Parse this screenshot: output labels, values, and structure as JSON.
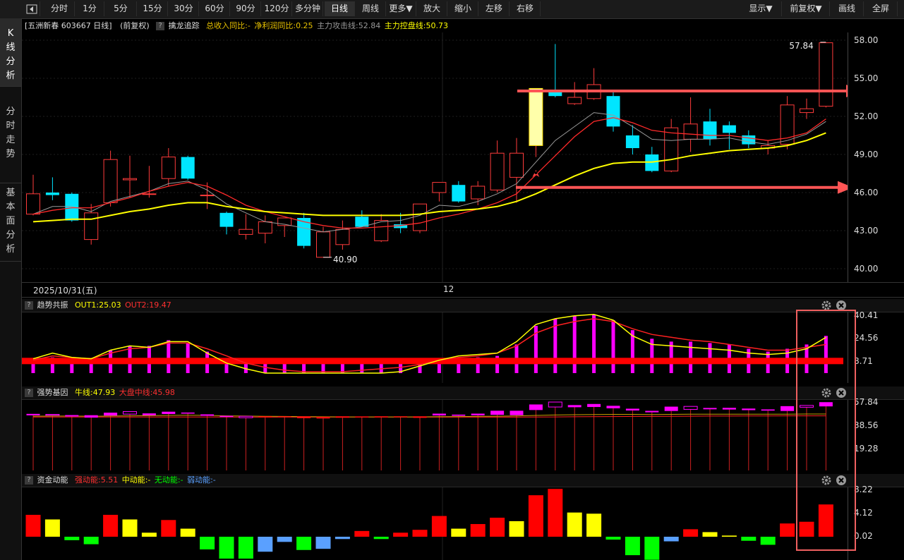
{
  "toolbar": {
    "collapse_icon": "collapse-left-icon",
    "periods": [
      "分时",
      "1分",
      "5分",
      "15分",
      "30分",
      "60分",
      "90分",
      "120分",
      "多分钟",
      "日线",
      "周线",
      "更多▼"
    ],
    "active_period": "日线",
    "actions": [
      "放大",
      "缩小",
      "左移",
      "右移"
    ],
    "right": [
      "显示▼",
      "前复权▼",
      "画线",
      "全屏"
    ]
  },
  "leftnav": [
    {
      "label": "K线分析",
      "active": true
    },
    {
      "label": "分时走势",
      "active": false
    },
    {
      "label": "基本面分析",
      "active": false
    }
  ],
  "main_chart": {
    "header": {
      "stock": "[五洲新春 603667 日线]",
      "adjust": "(前复权)",
      "indicator": "擒龙追踪",
      "items": [
        {
          "text": "总收入同比:-",
          "color": "#e8c200"
        },
        {
          "text": "净利润同比:0.25",
          "color": "#e8c200"
        },
        {
          "text": "主力攻击线:52.84",
          "color": "#999999"
        },
        {
          "text": "主力控盘线:50.73",
          "color": "#ffff00"
        }
      ]
    },
    "y_ticks": [
      "58.00",
      "55.00",
      "52.00",
      "49.00",
      "46.00",
      "43.00",
      "40.00"
    ],
    "high_label": "57.84",
    "low_label": "40.90",
    "date_label": "2025/10/31(五)",
    "month_label": "12",
    "colors": {
      "up": "#ff3b3b",
      "down": "#00e5ff",
      "ma_fast": "#dddddd",
      "ma_red": "#ff2a2a",
      "ma_yellow": "#ffff00",
      "arrow": "#ff5555",
      "highlight": "#ffffaa"
    }
  },
  "candles": [
    {
      "o": 44.3,
      "h": 47.4,
      "l": 44.2,
      "c": 45.9
    },
    {
      "o": 46.0,
      "h": 47.2,
      "l": 45.4,
      "c": 45.8
    },
    {
      "o": 45.9,
      "h": 46.0,
      "l": 43.7,
      "c": 43.8
    },
    {
      "o": 42.3,
      "h": 45.1,
      "l": 41.9,
      "c": 44.4
    },
    {
      "o": 45.2,
      "h": 49.3,
      "l": 44.9,
      "c": 48.6
    },
    {
      "o": 47.0,
      "h": 48.9,
      "l": 45.6,
      "c": 47.1
    },
    {
      "o": 45.9,
      "h": 48.1,
      "l": 45.6,
      "c": 45.9
    },
    {
      "o": 47.1,
      "h": 49.5,
      "l": 46.5,
      "c": 48.8
    },
    {
      "o": 48.8,
      "h": 48.9,
      "l": 47.0,
      "c": 47.1
    },
    {
      "o": 45.8,
      "h": 46.8,
      "l": 44.7,
      "c": 45.8
    },
    {
      "o": 44.4,
      "h": 44.5,
      "l": 42.7,
      "c": 43.3
    },
    {
      "o": 42.7,
      "h": 44.3,
      "l": 42.3,
      "c": 43.1
    },
    {
      "o": 42.8,
      "h": 44.2,
      "l": 42.0,
      "c": 43.7
    },
    {
      "o": 43.4,
      "h": 43.9,
      "l": 42.5,
      "c": 44.0
    },
    {
      "o": 44.0,
      "h": 44.4,
      "l": 41.6,
      "c": 41.8
    },
    {
      "o": 40.9,
      "h": 43.3,
      "l": 40.9,
      "c": 42.9
    },
    {
      "o": 41.9,
      "h": 43.8,
      "l": 41.5,
      "c": 43.1
    },
    {
      "o": 44.1,
      "h": 44.6,
      "l": 43.3,
      "c": 43.3
    },
    {
      "o": 42.2,
      "h": 44.3,
      "l": 42.1,
      "c": 43.8
    },
    {
      "o": 43.5,
      "h": 44.4,
      "l": 42.8,
      "c": 43.2
    },
    {
      "o": 43.0,
      "h": 45.1,
      "l": 42.8,
      "c": 45.1
    },
    {
      "o": 46.0,
      "h": 46.7,
      "l": 45.3,
      "c": 46.8
    },
    {
      "o": 46.6,
      "h": 46.9,
      "l": 45.2,
      "c": 45.3
    },
    {
      "o": 45.5,
      "h": 46.9,
      "l": 45.0,
      "c": 46.5
    },
    {
      "o": 46.2,
      "h": 50.1,
      "l": 46.0,
      "c": 49.1
    },
    {
      "o": 47.2,
      "h": 50.3,
      "l": 45.2,
      "c": 49.1
    },
    {
      "o": 49.7,
      "h": 54.2,
      "l": 48.8,
      "c": 54.2,
      "highlight": true
    },
    {
      "o": 54.0,
      "h": 57.7,
      "l": 53.5,
      "c": 53.6
    },
    {
      "o": 53.0,
      "h": 54.7,
      "l": 52.9,
      "c": 53.5
    },
    {
      "o": 53.4,
      "h": 55.8,
      "l": 53.3,
      "c": 54.5
    },
    {
      "o": 53.6,
      "h": 53.9,
      "l": 50.8,
      "c": 51.2
    },
    {
      "o": 50.5,
      "h": 51.3,
      "l": 49.0,
      "c": 49.5
    },
    {
      "o": 49.0,
      "h": 49.6,
      "l": 47.6,
      "c": 47.7
    },
    {
      "o": 47.7,
      "h": 51.8,
      "l": 47.6,
      "c": 51.1
    },
    {
      "o": 50.2,
      "h": 53.5,
      "l": 49.2,
      "c": 51.4
    },
    {
      "o": 51.6,
      "h": 52.6,
      "l": 49.7,
      "c": 50.2
    },
    {
      "o": 51.3,
      "h": 51.6,
      "l": 49.4,
      "c": 50.7
    },
    {
      "o": 50.5,
      "h": 50.9,
      "l": 49.5,
      "c": 49.8
    },
    {
      "o": 49.5,
      "h": 50.1,
      "l": 49.0,
      "c": 49.7
    },
    {
      "o": 49.8,
      "h": 53.6,
      "l": 49.4,
      "c": 52.9
    },
    {
      "o": 52.3,
      "h": 53.4,
      "l": 51.8,
      "c": 52.6
    },
    {
      "o": 52.8,
      "h": 57.8,
      "l": 52.7,
      "c": 57.8
    }
  ],
  "ma_gray": [
    44.3,
    44.9,
    44.9,
    44.5,
    45.3,
    45.7,
    46.1,
    46.7,
    46.9,
    46.2,
    45.1,
    44.4,
    43.7,
    43.5,
    43.2,
    42.9,
    43.1,
    43.3,
    43.7,
    43.8,
    44.2,
    45.0,
    44.9,
    45.3,
    45.9,
    46.7,
    48.4,
    50.1,
    51.2,
    52.3,
    52.1,
    51.2,
    50.2,
    50.1,
    50.2,
    50.2,
    50.3,
    50.0,
    49.8,
    50.1,
    50.6,
    51.6
  ],
  "ma_red": [
    44.3,
    44.6,
    44.8,
    44.8,
    45.2,
    45.6,
    46.1,
    46.5,
    46.8,
    46.5,
    45.8,
    45.0,
    44.5,
    44.1,
    43.7,
    43.4,
    43.2,
    43.2,
    43.3,
    43.4,
    43.6,
    44.0,
    44.3,
    44.7,
    45.2,
    45.9,
    47.4,
    48.9,
    50.4,
    51.6,
    51.9,
    51.5,
    50.9,
    50.7,
    50.6,
    50.5,
    50.5,
    50.3,
    50.1,
    50.3,
    50.7,
    51.8
  ],
  "ma_yellow": [
    43.7,
    43.8,
    43.9,
    43.9,
    44.2,
    44.5,
    44.7,
    45.0,
    45.2,
    45.2,
    44.9,
    44.7,
    44.5,
    44.4,
    44.3,
    44.2,
    44.2,
    44.2,
    44.2,
    44.2,
    44.3,
    44.5,
    44.6,
    44.7,
    44.9,
    45.3,
    45.9,
    46.6,
    47.3,
    47.9,
    48.3,
    48.4,
    48.4,
    48.6,
    48.9,
    49.1,
    49.3,
    49.4,
    49.5,
    49.7,
    50.1,
    50.7
  ],
  "panel1": {
    "title": "趋势共振",
    "items": [
      {
        "text": "OUT1:25.03",
        "color": "#ffff00"
      },
      {
        "text": "OUT2:19.47",
        "color": "#ff3030"
      }
    ],
    "y_ticks": [
      "40.41",
      "24.56",
      "8.71"
    ],
    "bars": [
      8.7,
      11,
      9,
      9,
      16,
      19,
      19,
      23,
      21,
      15,
      8.7,
      8.7,
      8.7,
      8.7,
      8.7,
      8.7,
      8.7,
      8.7,
      8.7,
      8.7,
      8.7,
      8.7,
      8.7,
      11,
      12,
      20,
      33,
      38,
      40,
      41,
      37,
      30,
      24,
      22,
      22,
      21,
      20,
      17,
      15,
      17,
      20,
      26
    ],
    "line_yellow": [
      10,
      14,
      11,
      10,
      16,
      19,
      18,
      22,
      22,
      14,
      7,
      3,
      0,
      0,
      0,
      0,
      0,
      0,
      0,
      1,
      5,
      9,
      12,
      13,
      14,
      22,
      34,
      38,
      40,
      41,
      37,
      26,
      20,
      19,
      18,
      17,
      16,
      14,
      13,
      14,
      17,
      25
    ],
    "line_red": [
      9,
      12,
      11,
      10,
      14,
      17,
      18,
      21,
      21,
      17,
      12,
      7,
      4,
      2,
      1,
      1,
      1,
      2,
      3,
      4,
      6,
      9,
      11,
      12,
      14,
      19,
      28,
      33,
      36,
      38,
      36,
      31,
      27,
      25,
      23,
      22,
      20,
      18,
      16,
      16,
      18,
      20
    ]
  },
  "panel2": {
    "title": "强势基因",
    "items": [
      {
        "text": "牛线:47.93",
        "color": "#ffff00"
      },
      {
        "text": "大盘中线:45.98",
        "color": "#ff3030"
      }
    ],
    "y_ticks": [
      "57.84",
      "38.56",
      "19.28"
    ],
    "bars": [
      {
        "o": 47.4,
        "c": 48.6,
        "up": false
      },
      {
        "o": 47.4,
        "c": 48.2,
        "up": true
      },
      {
        "o": 46.4,
        "c": 47.6,
        "up": false
      },
      {
        "o": 45.5,
        "c": 47.5,
        "up": false
      },
      {
        "o": 47.2,
        "c": 49.6,
        "up": false
      },
      {
        "o": 48.4,
        "c": 50.5,
        "up": true
      },
      {
        "o": 47.4,
        "c": 49.0,
        "up": false
      },
      {
        "o": 48.5,
        "c": 50.4,
        "up": false
      },
      {
        "o": 48.8,
        "c": 49.7,
        "up": false
      },
      {
        "o": 47.0,
        "c": 48.2,
        "up": false
      },
      {
        "o": 46.0,
        "c": 47.0,
        "up": false
      },
      {
        "o": 45.4,
        "c": 46.6,
        "up": true
      },
      {
        "o": 45.6,
        "c": 46.6,
        "up": false
      },
      {
        "o": 45.9,
        "c": 46.6,
        "up": false
      },
      {
        "o": 45.0,
        "c": 46.6,
        "up": false
      },
      {
        "o": 44.8,
        "c": 46.2,
        "up": false
      },
      {
        "o": 45.4,
        "c": 46.6,
        "up": false
      },
      {
        "o": 45.6,
        "c": 46.5,
        "up": false
      },
      {
        "o": 45.7,
        "c": 46.6,
        "up": false
      },
      {
        "o": 45.9,
        "c": 46.6,
        "up": false
      },
      {
        "o": 45.3,
        "c": 46.6,
        "up": false
      },
      {
        "o": 47.3,
        "c": 48.8,
        "up": false
      },
      {
        "o": 47.0,
        "c": 48.0,
        "up": false
      },
      {
        "o": 47.4,
        "c": 48.8,
        "up": false
      },
      {
        "o": 47.8,
        "c": 51.2,
        "up": false
      },
      {
        "o": 47.5,
        "c": 51.2,
        "up": false
      },
      {
        "o": 51.8,
        "c": 56.4,
        "up": false
      },
      {
        "o": 54.3,
        "c": 58.4,
        "up": true
      },
      {
        "o": 54.1,
        "c": 55.9,
        "up": false
      },
      {
        "o": 54.3,
        "c": 56.8,
        "up": false
      },
      {
        "o": 53.2,
        "c": 55.3,
        "up": false
      },
      {
        "o": 51.4,
        "c": 52.9,
        "up": false
      },
      {
        "o": 49.9,
        "c": 51.1,
        "up": false
      },
      {
        "o": 51.0,
        "c": 54.6,
        "up": false
      },
      {
        "o": 52.3,
        "c": 54.8,
        "up": true
      },
      {
        "o": 52.4,
        "c": 53.5,
        "up": false
      },
      {
        "o": 52.2,
        "c": 53.6,
        "up": false
      },
      {
        "o": 51.7,
        "c": 53.0,
        "up": false
      },
      {
        "o": 51.3,
        "c": 52.3,
        "up": false
      },
      {
        "o": 51.0,
        "c": 55.0,
        "up": false
      },
      {
        "o": 54.1,
        "c": 55.6,
        "up": true
      },
      {
        "o": 54.8,
        "c": 58.3,
        "up": false
      }
    ],
    "line_yellow": [
      46.7,
      46.8,
      46.8,
      46.6,
      46.8,
      47.0,
      47.1,
      47.3,
      47.5,
      47.3,
      47.0,
      46.8,
      46.6,
      46.5,
      46.3,
      46.2,
      46.1,
      46.1,
      46.1,
      46.1,
      46.1,
      46.3,
      46.4,
      46.5,
      46.7,
      46.9,
      47.3,
      47.7,
      47.9,
      48.1,
      48.2,
      48.2,
      48.1,
      48.2,
      48.3,
      48.4,
      48.4,
      48.4,
      48.4,
      48.4,
      48.5,
      48.5
    ],
    "line_red": [
      46.0,
      46.0,
      46.0,
      46.0,
      46.0,
      46.0,
      46.0,
      46.0,
      46.0,
      46.0,
      46.0,
      45.9,
      45.9,
      45.9,
      45.9,
      45.9,
      45.9,
      45.9,
      45.9,
      45.9,
      45.9,
      45.9,
      45.9,
      45.9,
      45.9,
      45.9,
      46.0,
      46.1,
      46.2,
      46.3,
      46.4,
      46.5,
      46.5,
      46.6,
      46.7,
      46.8,
      46.8,
      46.9,
      46.9,
      47.0,
      47.0,
      47.0
    ]
  },
  "panel3": {
    "title": "资金动能",
    "items": [
      {
        "text": "强动能:5.51",
        "color": "#ff3030"
      },
      {
        "text": "中动能:-",
        "color": "#ffff00"
      },
      {
        "text": "无动能:-",
        "color": "#00ff00"
      },
      {
        "text": "弱动能:-",
        "color": "#5aa0ff"
      }
    ],
    "y_ticks": [
      "8.22",
      "4.12",
      "0.02"
    ],
    "colors": {
      "strong": "#ff0000",
      "mid": "#ffff00",
      "none": "#00ff00",
      "weak": "#5aa0ff"
    },
    "bars": [
      {
        "v": 3.8,
        "t": "strong"
      },
      {
        "v": 3.0,
        "t": "mid"
      },
      {
        "v": -0.6,
        "t": "none"
      },
      {
        "v": -1.3,
        "t": "none"
      },
      {
        "v": 3.8,
        "t": "strong"
      },
      {
        "v": 3.0,
        "t": "mid"
      },
      {
        "v": 0.7,
        "t": "mid"
      },
      {
        "v": 2.9,
        "t": "strong"
      },
      {
        "v": 1.4,
        "t": "mid"
      },
      {
        "v": -2.2,
        "t": "none"
      },
      {
        "v": -3.8,
        "t": "none"
      },
      {
        "v": -3.8,
        "t": "none"
      },
      {
        "v": -2.6,
        "t": "weak"
      },
      {
        "v": -0.9,
        "t": "weak"
      },
      {
        "v": -2.3,
        "t": "none"
      },
      {
        "v": -2.1,
        "t": "weak"
      },
      {
        "v": -0.4,
        "t": "weak"
      },
      {
        "v": 1.0,
        "t": "strong"
      },
      {
        "v": -0.4,
        "t": "none"
      },
      {
        "v": 0.7,
        "t": "strong"
      },
      {
        "v": 1.2,
        "t": "strong"
      },
      {
        "v": 3.6,
        "t": "strong"
      },
      {
        "v": 1.4,
        "t": "mid"
      },
      {
        "v": 2.2,
        "t": "strong"
      },
      {
        "v": 3.3,
        "t": "strong"
      },
      {
        "v": 2.7,
        "t": "mid"
      },
      {
        "v": 7.2,
        "t": "strong"
      },
      {
        "v": 8.3,
        "t": "strong"
      },
      {
        "v": 4.2,
        "t": "mid"
      },
      {
        "v": 4.0,
        "t": "mid"
      },
      {
        "v": -0.5,
        "t": "none"
      },
      {
        "v": -3.2,
        "t": "none"
      },
      {
        "v": -4.0,
        "t": "none"
      },
      {
        "v": -0.8,
        "t": "weak"
      },
      {
        "v": 1.3,
        "t": "strong"
      },
      {
        "v": 0.8,
        "t": "mid"
      },
      {
        "v": 0.2,
        "t": "mid"
      },
      {
        "v": -0.7,
        "t": "none"
      },
      {
        "v": -1.4,
        "t": "none"
      },
      {
        "v": 2.3,
        "t": "strong"
      },
      {
        "v": 2.6,
        "t": "strong"
      },
      {
        "v": 5.6,
        "t": "strong"
      }
    ]
  }
}
